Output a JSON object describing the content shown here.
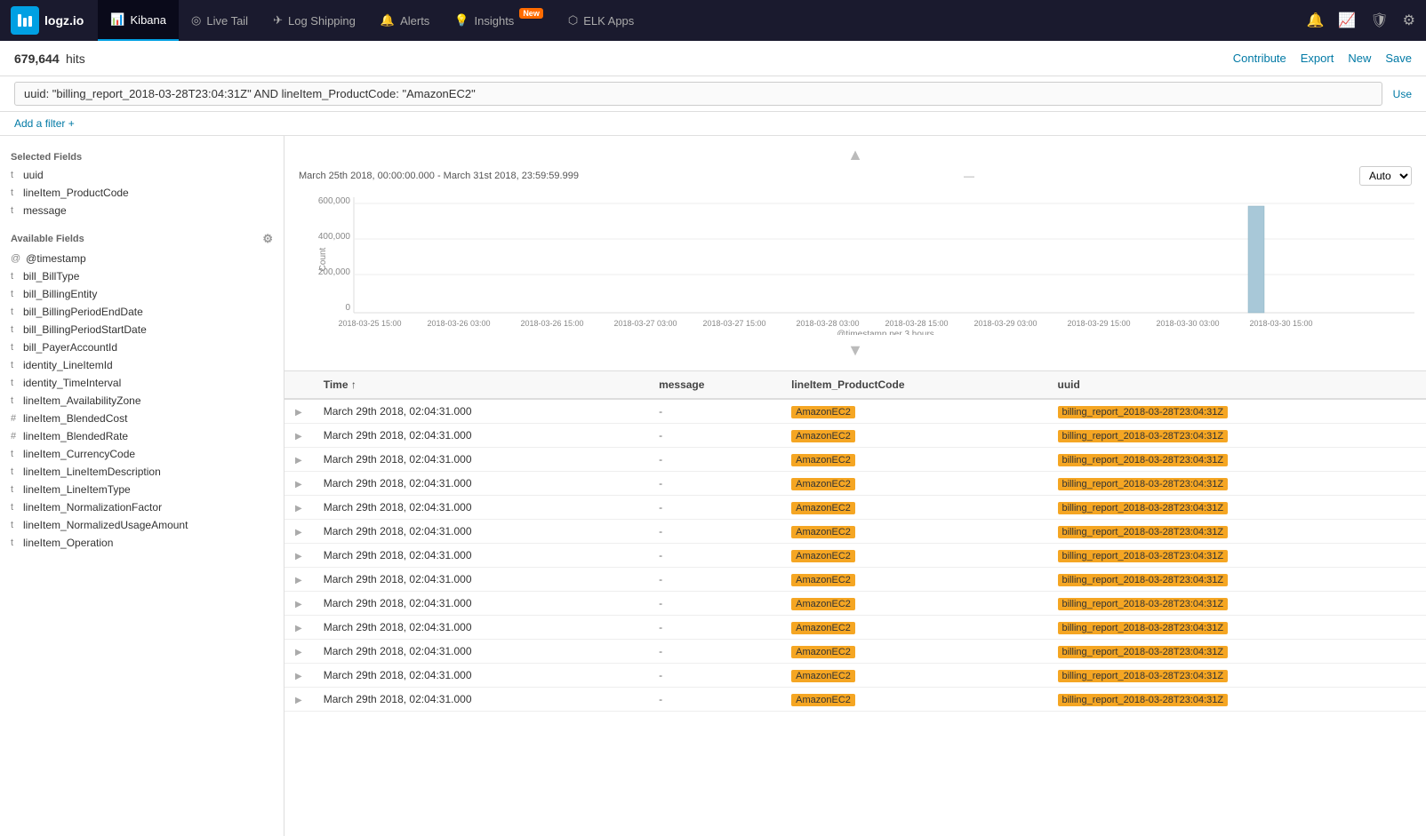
{
  "nav": {
    "logo_text": "logz.io",
    "items": [
      {
        "id": "kibana",
        "label": "Kibana",
        "icon": "📊",
        "active": true,
        "badge": null
      },
      {
        "id": "livetail",
        "label": "Live Tail",
        "icon": "◎",
        "active": false,
        "badge": null
      },
      {
        "id": "logshipping",
        "label": "Log Shipping",
        "icon": "✈",
        "active": false,
        "badge": null
      },
      {
        "id": "alerts",
        "label": "Alerts",
        "icon": "🔔",
        "active": false,
        "badge": null
      },
      {
        "id": "insights",
        "label": "Insights",
        "icon": "💡",
        "active": false,
        "badge": "New"
      },
      {
        "id": "elkapps",
        "label": "ELK Apps",
        "icon": "⬡",
        "active": false,
        "badge": null
      }
    ]
  },
  "toolbar": {
    "hits_count": "679,644",
    "hits_label": "hits",
    "contribute_label": "Contribute",
    "export_label": "Export",
    "new_label": "New",
    "save_label": "Save"
  },
  "search": {
    "query": "uuid: \"billing_report_2018-03-28T23:04:31Z\" AND lineItem_ProductCode: \"AmazonEC2\"",
    "use_lucene_label": "Use"
  },
  "filter": {
    "add_filter_label": "Add a filter +"
  },
  "sidebar": {
    "selected_fields_title": "Selected Fields",
    "available_fields_title": "Available Fields",
    "selected_fields": [
      {
        "type": "t",
        "name": "uuid"
      },
      {
        "type": "t",
        "name": "lineItem_ProductCode"
      },
      {
        "type": "t",
        "name": "message"
      }
    ],
    "available_fields": [
      {
        "type": "@",
        "name": "@timestamp"
      },
      {
        "type": "t",
        "name": "bill_BillType"
      },
      {
        "type": "t",
        "name": "bill_BillingEntity"
      },
      {
        "type": "t",
        "name": "bill_BillingPeriodEndDate"
      },
      {
        "type": "t",
        "name": "bill_BillingPeriodStartDate"
      },
      {
        "type": "t",
        "name": "bill_PayerAccountId"
      },
      {
        "type": "t",
        "name": "identity_LineItemId"
      },
      {
        "type": "t",
        "name": "identity_TimeInterval"
      },
      {
        "type": "t",
        "name": "lineItem_AvailabilityZone"
      },
      {
        "type": "#",
        "name": "lineItem_BlendedCost"
      },
      {
        "type": "#",
        "name": "lineItem_BlendedRate"
      },
      {
        "type": "t",
        "name": "lineItem_CurrencyCode"
      },
      {
        "type": "t",
        "name": "lineItem_LineItemDescription"
      },
      {
        "type": "t",
        "name": "lineItem_LineItemType"
      },
      {
        "type": "t",
        "name": "lineItem_NormalizationFactor"
      },
      {
        "type": "t",
        "name": "lineItem_NormalizedUsageAmount"
      },
      {
        "type": "t",
        "name": "lineItem_Operation"
      }
    ]
  },
  "chart": {
    "range": "March 25th 2018, 00:00:00.000 - March 31st 2018, 23:59:59.999",
    "interval_label": "Auto",
    "x_axis_label": "@timestamp per 3 hours",
    "y_axis_label": "Count",
    "y_ticks": [
      "600,000",
      "400,000",
      "200,000",
      "0"
    ],
    "x_labels": [
      "2018-03-25 15:00",
      "2018-03-26 03:00",
      "2018-03-26 15:00",
      "2018-03-27 03:00",
      "2018-03-27 15:00",
      "2018-03-28 03:00",
      "2018-03-28 15:00",
      "2018-03-29 03:00",
      "2018-03-29 15:00",
      "2018-03-30 03:00",
      "2018-03-30 15:00"
    ]
  },
  "table": {
    "columns": [
      "Time",
      "message",
      "lineItem_ProductCode",
      "uuid"
    ],
    "rows": [
      {
        "time": "March 29th 2018, 02:04:31.000",
        "message": "-",
        "product": "AmazonEC2",
        "uuid": "billing_report_2018-03-28T23:04:31Z"
      },
      {
        "time": "March 29th 2018, 02:04:31.000",
        "message": "-",
        "product": "AmazonEC2",
        "uuid": "billing_report_2018-03-28T23:04:31Z"
      },
      {
        "time": "March 29th 2018, 02:04:31.000",
        "message": "-",
        "product": "AmazonEC2",
        "uuid": "billing_report_2018-03-28T23:04:31Z"
      },
      {
        "time": "March 29th 2018, 02:04:31.000",
        "message": "-",
        "product": "AmazonEC2",
        "uuid": "billing_report_2018-03-28T23:04:31Z"
      },
      {
        "time": "March 29th 2018, 02:04:31.000",
        "message": "-",
        "product": "AmazonEC2",
        "uuid": "billing_report_2018-03-28T23:04:31Z"
      },
      {
        "time": "March 29th 2018, 02:04:31.000",
        "message": "-",
        "product": "AmazonEC2",
        "uuid": "billing_report_2018-03-28T23:04:31Z"
      },
      {
        "time": "March 29th 2018, 02:04:31.000",
        "message": "-",
        "product": "AmazonEC2",
        "uuid": "billing_report_2018-03-28T23:04:31Z"
      },
      {
        "time": "March 29th 2018, 02:04:31.000",
        "message": "-",
        "product": "AmazonEC2",
        "uuid": "billing_report_2018-03-28T23:04:31Z"
      },
      {
        "time": "March 29th 2018, 02:04:31.000",
        "message": "-",
        "product": "AmazonEC2",
        "uuid": "billing_report_2018-03-28T23:04:31Z"
      },
      {
        "time": "March 29th 2018, 02:04:31.000",
        "message": "-",
        "product": "AmazonEC2",
        "uuid": "billing_report_2018-03-28T23:04:31Z"
      },
      {
        "time": "March 29th 2018, 02:04:31.000",
        "message": "-",
        "product": "AmazonEC2",
        "uuid": "billing_report_2018-03-28T23:04:31Z"
      },
      {
        "time": "March 29th 2018, 02:04:31.000",
        "message": "-",
        "product": "AmazonEC2",
        "uuid": "billing_report_2018-03-28T23:04:31Z"
      },
      {
        "time": "March 29th 2018, 02:04:31.000",
        "message": "-",
        "product": "AmazonEC2",
        "uuid": "billing_report_2018-03-28T23:04:31Z"
      }
    ]
  }
}
